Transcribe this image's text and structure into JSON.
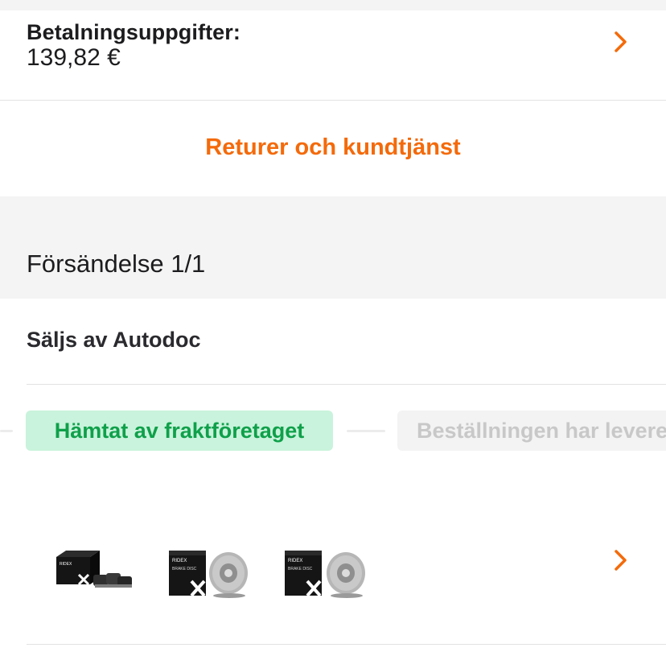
{
  "payment": {
    "label": "Betalningsuppgifter:",
    "amount": "139,82 €"
  },
  "returns": {
    "link_label": "Returer och kundtjänst"
  },
  "shipment": {
    "title": "Försändelse 1/1",
    "seller": "Säljs av Autodoc",
    "statuses": [
      {
        "label": "Hämtat av fraktföretaget",
        "state": "active"
      },
      {
        "label": "Beställningen har levererats",
        "state": "inactive"
      }
    ],
    "products": [
      {
        "icon": "brake-pads-icon",
        "brand": "RIDEX"
      },
      {
        "icon": "brake-disc-icon",
        "brand": "RIDEX",
        "box_text": "BRAKE DISC"
      },
      {
        "icon": "brake-disc-icon",
        "brand": "RIDEX",
        "box_text": "BRAKE DISC"
      }
    ]
  },
  "colors": {
    "accent": "#f46a0a",
    "status_active_bg": "#c9f3dc",
    "status_active_text": "#0fa04a",
    "status_inactive_bg": "#f3f3f3",
    "status_inactive_text": "#c8c8c8",
    "section_bg": "#f4f4f4"
  }
}
